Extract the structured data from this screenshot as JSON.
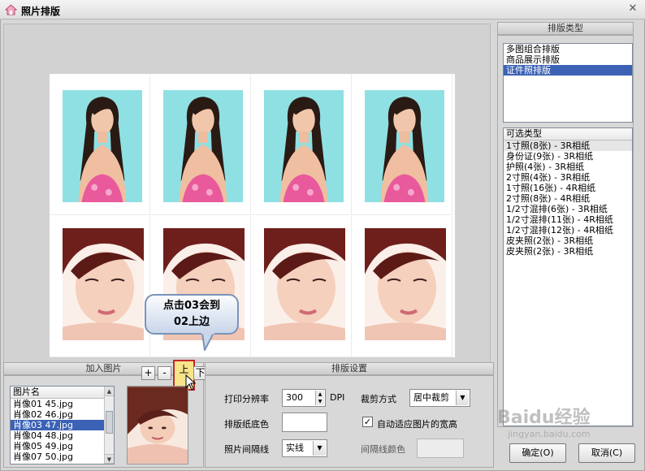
{
  "window": {
    "title": "照片排版"
  },
  "layout_type_panel": {
    "header": "排版类型",
    "items": [
      "多图组合排版",
      "商品展示排版",
      "证件照排版"
    ],
    "selected_index": 2
  },
  "optional_types_panel": {
    "header": "可选类型",
    "items": [
      "1寸照(8张) - 3R相纸",
      "身份证(9张) - 3R相纸",
      "护照(4张) - 3R相纸",
      "2寸照(4张) - 3R相纸",
      "1寸照(16张) - 4R相纸",
      "2寸照(8张) - 4R相纸",
      "1/2寸混排(6张) - 3R相纸",
      "1/2寸混排(11张) - 4R相纸",
      "1/2寸混排(12张) - 4R相纸",
      "皮夹照(2张) - 3R相纸",
      "皮夹照(2张) - 3R相纸"
    ]
  },
  "callout": {
    "line1": "点击03会到",
    "line2": "02上边"
  },
  "add_images": {
    "header": "加入图片",
    "buttons": {
      "add": "+",
      "remove": "-",
      "up": "上",
      "down": "下"
    },
    "list_header": "图片名",
    "files": [
      "肖像01 45.jpg",
      "肖像02 46.jpg",
      "肖像03 47.jpg",
      "肖像04 48.jpg",
      "肖像05 49.jpg",
      "肖像07 50.jpg"
    ],
    "selected_index": 2
  },
  "layout_settings": {
    "header": "排版设置",
    "print_resolution_label": "打印分辨率",
    "print_resolution_value": "300",
    "dpi_unit": "DPI",
    "crop_mode_label": "裁剪方式",
    "crop_mode_value": "居中裁剪",
    "paper_bg_label": "排版纸底色",
    "auto_fit_label": "自动适应图片的宽高",
    "auto_fit_checked": true,
    "spacing_line_label": "照片间隔线",
    "spacing_line_value": "实线",
    "spacing_color_label": "间隔线颜色"
  },
  "footer_buttons": {
    "ok": "确定(O)",
    "cancel": "取消(C)"
  },
  "watermark": {
    "brand": "Baidu经验",
    "url": "jingyan.baidu.com"
  },
  "colors": {
    "selection": "#3b62b5",
    "photo_bg_top": "#8fe0e3",
    "highlight_border": "#c1272d"
  }
}
